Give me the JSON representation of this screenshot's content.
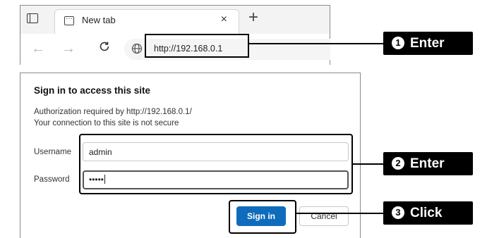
{
  "browser": {
    "tab_title": "New tab",
    "tab_close": "×",
    "new_tab": "+",
    "back": "←",
    "forward": "→",
    "refresh": "C",
    "url": "http://192.168.0.1"
  },
  "dialog": {
    "title": "Sign in to access this site",
    "line1": "Authorization required by http://192.168.0.1/",
    "line2": "Your connection to this site is not secure",
    "username_label": "Username",
    "username_value": "admin",
    "password_label": "Password",
    "password_value": "•••••",
    "signin_label": "Sign in",
    "cancel_label": "Cancel"
  },
  "callouts": [
    {
      "num": "1",
      "text": "Enter"
    },
    {
      "num": "2",
      "text": "Enter"
    },
    {
      "num": "3",
      "text": "Click"
    }
  ],
  "colors": {
    "signin_button": "#0f6cbd",
    "callout_bg": "#000000"
  }
}
